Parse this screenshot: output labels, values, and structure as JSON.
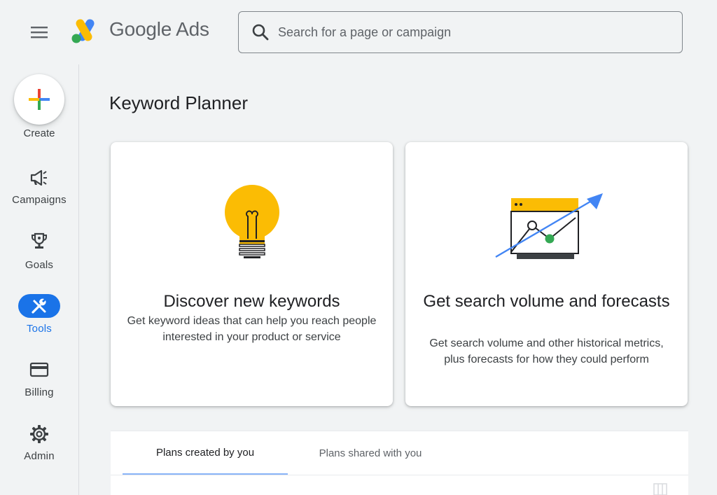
{
  "header": {
    "logo_text": "Google Ads",
    "search_placeholder": "Search for a page or campaign"
  },
  "sidebar": {
    "create_label": "Create",
    "items": [
      {
        "id": "campaigns",
        "label": "Campaigns",
        "icon": "megaphone-icon",
        "active": false
      },
      {
        "id": "goals",
        "label": "Goals",
        "icon": "trophy-icon",
        "active": false
      },
      {
        "id": "tools",
        "label": "Tools",
        "icon": "tools-icon",
        "active": true
      },
      {
        "id": "billing",
        "label": "Billing",
        "icon": "credit-card-icon",
        "active": false
      },
      {
        "id": "admin",
        "label": "Admin",
        "icon": "gear-icon",
        "active": false
      }
    ]
  },
  "main": {
    "title": "Keyword Planner",
    "cards": [
      {
        "title": "Discover new keywords",
        "description": "Get keyword ideas that can help you reach people interested in your product or service",
        "illustration": "lightbulb-icon"
      },
      {
        "title": "Get search volume and forecasts",
        "description": "Get search volume and other historical metrics, plus forecasts for how they could perform",
        "illustration": "trend-chart-icon"
      }
    ],
    "tabs": [
      {
        "label": "Plans created by you",
        "active": true
      },
      {
        "label": "Plans shared with you",
        "active": false
      }
    ]
  },
  "colors": {
    "accent": "#1a73e8",
    "background": "#f1f3f4",
    "card_bg": "#ffffff",
    "bulb_yellow": "#fbbc04",
    "chart_green": "#34a853",
    "chart_arrow": "#4285f4"
  }
}
